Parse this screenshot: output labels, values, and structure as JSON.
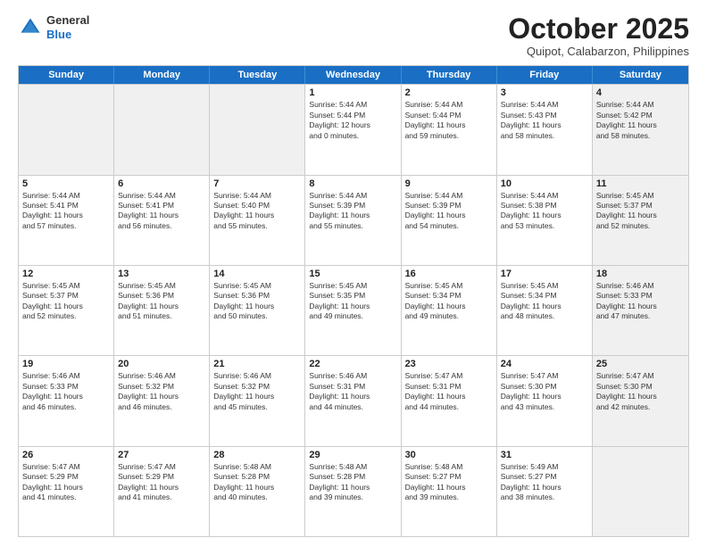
{
  "header": {
    "logo_general": "General",
    "logo_blue": "Blue",
    "month_title": "October 2025",
    "subtitle": "Quipot, Calabarzon, Philippines"
  },
  "weekdays": [
    "Sunday",
    "Monday",
    "Tuesday",
    "Wednesday",
    "Thursday",
    "Friday",
    "Saturday"
  ],
  "rows": [
    [
      {
        "day": "",
        "text": "",
        "shaded": true
      },
      {
        "day": "",
        "text": "",
        "shaded": true
      },
      {
        "day": "",
        "text": "",
        "shaded": true
      },
      {
        "day": "1",
        "text": "Sunrise: 5:44 AM\nSunset: 5:44 PM\nDaylight: 12 hours\nand 0 minutes.",
        "shaded": false
      },
      {
        "day": "2",
        "text": "Sunrise: 5:44 AM\nSunset: 5:44 PM\nDaylight: 11 hours\nand 59 minutes.",
        "shaded": false
      },
      {
        "day": "3",
        "text": "Sunrise: 5:44 AM\nSunset: 5:43 PM\nDaylight: 11 hours\nand 58 minutes.",
        "shaded": false
      },
      {
        "day": "4",
        "text": "Sunrise: 5:44 AM\nSunset: 5:42 PM\nDaylight: 11 hours\nand 58 minutes.",
        "shaded": true
      }
    ],
    [
      {
        "day": "5",
        "text": "Sunrise: 5:44 AM\nSunset: 5:41 PM\nDaylight: 11 hours\nand 57 minutes.",
        "shaded": false
      },
      {
        "day": "6",
        "text": "Sunrise: 5:44 AM\nSunset: 5:41 PM\nDaylight: 11 hours\nand 56 minutes.",
        "shaded": false
      },
      {
        "day": "7",
        "text": "Sunrise: 5:44 AM\nSunset: 5:40 PM\nDaylight: 11 hours\nand 55 minutes.",
        "shaded": false
      },
      {
        "day": "8",
        "text": "Sunrise: 5:44 AM\nSunset: 5:39 PM\nDaylight: 11 hours\nand 55 minutes.",
        "shaded": false
      },
      {
        "day": "9",
        "text": "Sunrise: 5:44 AM\nSunset: 5:39 PM\nDaylight: 11 hours\nand 54 minutes.",
        "shaded": false
      },
      {
        "day": "10",
        "text": "Sunrise: 5:44 AM\nSunset: 5:38 PM\nDaylight: 11 hours\nand 53 minutes.",
        "shaded": false
      },
      {
        "day": "11",
        "text": "Sunrise: 5:45 AM\nSunset: 5:37 PM\nDaylight: 11 hours\nand 52 minutes.",
        "shaded": true
      }
    ],
    [
      {
        "day": "12",
        "text": "Sunrise: 5:45 AM\nSunset: 5:37 PM\nDaylight: 11 hours\nand 52 minutes.",
        "shaded": false
      },
      {
        "day": "13",
        "text": "Sunrise: 5:45 AM\nSunset: 5:36 PM\nDaylight: 11 hours\nand 51 minutes.",
        "shaded": false
      },
      {
        "day": "14",
        "text": "Sunrise: 5:45 AM\nSunset: 5:36 PM\nDaylight: 11 hours\nand 50 minutes.",
        "shaded": false
      },
      {
        "day": "15",
        "text": "Sunrise: 5:45 AM\nSunset: 5:35 PM\nDaylight: 11 hours\nand 49 minutes.",
        "shaded": false
      },
      {
        "day": "16",
        "text": "Sunrise: 5:45 AM\nSunset: 5:34 PM\nDaylight: 11 hours\nand 49 minutes.",
        "shaded": false
      },
      {
        "day": "17",
        "text": "Sunrise: 5:45 AM\nSunset: 5:34 PM\nDaylight: 11 hours\nand 48 minutes.",
        "shaded": false
      },
      {
        "day": "18",
        "text": "Sunrise: 5:46 AM\nSunset: 5:33 PM\nDaylight: 11 hours\nand 47 minutes.",
        "shaded": true
      }
    ],
    [
      {
        "day": "19",
        "text": "Sunrise: 5:46 AM\nSunset: 5:33 PM\nDaylight: 11 hours\nand 46 minutes.",
        "shaded": false
      },
      {
        "day": "20",
        "text": "Sunrise: 5:46 AM\nSunset: 5:32 PM\nDaylight: 11 hours\nand 46 minutes.",
        "shaded": false
      },
      {
        "day": "21",
        "text": "Sunrise: 5:46 AM\nSunset: 5:32 PM\nDaylight: 11 hours\nand 45 minutes.",
        "shaded": false
      },
      {
        "day": "22",
        "text": "Sunrise: 5:46 AM\nSunset: 5:31 PM\nDaylight: 11 hours\nand 44 minutes.",
        "shaded": false
      },
      {
        "day": "23",
        "text": "Sunrise: 5:47 AM\nSunset: 5:31 PM\nDaylight: 11 hours\nand 44 minutes.",
        "shaded": false
      },
      {
        "day": "24",
        "text": "Sunrise: 5:47 AM\nSunset: 5:30 PM\nDaylight: 11 hours\nand 43 minutes.",
        "shaded": false
      },
      {
        "day": "25",
        "text": "Sunrise: 5:47 AM\nSunset: 5:30 PM\nDaylight: 11 hours\nand 42 minutes.",
        "shaded": true
      }
    ],
    [
      {
        "day": "26",
        "text": "Sunrise: 5:47 AM\nSunset: 5:29 PM\nDaylight: 11 hours\nand 41 minutes.",
        "shaded": false
      },
      {
        "day": "27",
        "text": "Sunrise: 5:47 AM\nSunset: 5:29 PM\nDaylight: 11 hours\nand 41 minutes.",
        "shaded": false
      },
      {
        "day": "28",
        "text": "Sunrise: 5:48 AM\nSunset: 5:28 PM\nDaylight: 11 hours\nand 40 minutes.",
        "shaded": false
      },
      {
        "day": "29",
        "text": "Sunrise: 5:48 AM\nSunset: 5:28 PM\nDaylight: 11 hours\nand 39 minutes.",
        "shaded": false
      },
      {
        "day": "30",
        "text": "Sunrise: 5:48 AM\nSunset: 5:27 PM\nDaylight: 11 hours\nand 39 minutes.",
        "shaded": false
      },
      {
        "day": "31",
        "text": "Sunrise: 5:49 AM\nSunset: 5:27 PM\nDaylight: 11 hours\nand 38 minutes.",
        "shaded": false
      },
      {
        "day": "",
        "text": "",
        "shaded": true
      }
    ]
  ]
}
